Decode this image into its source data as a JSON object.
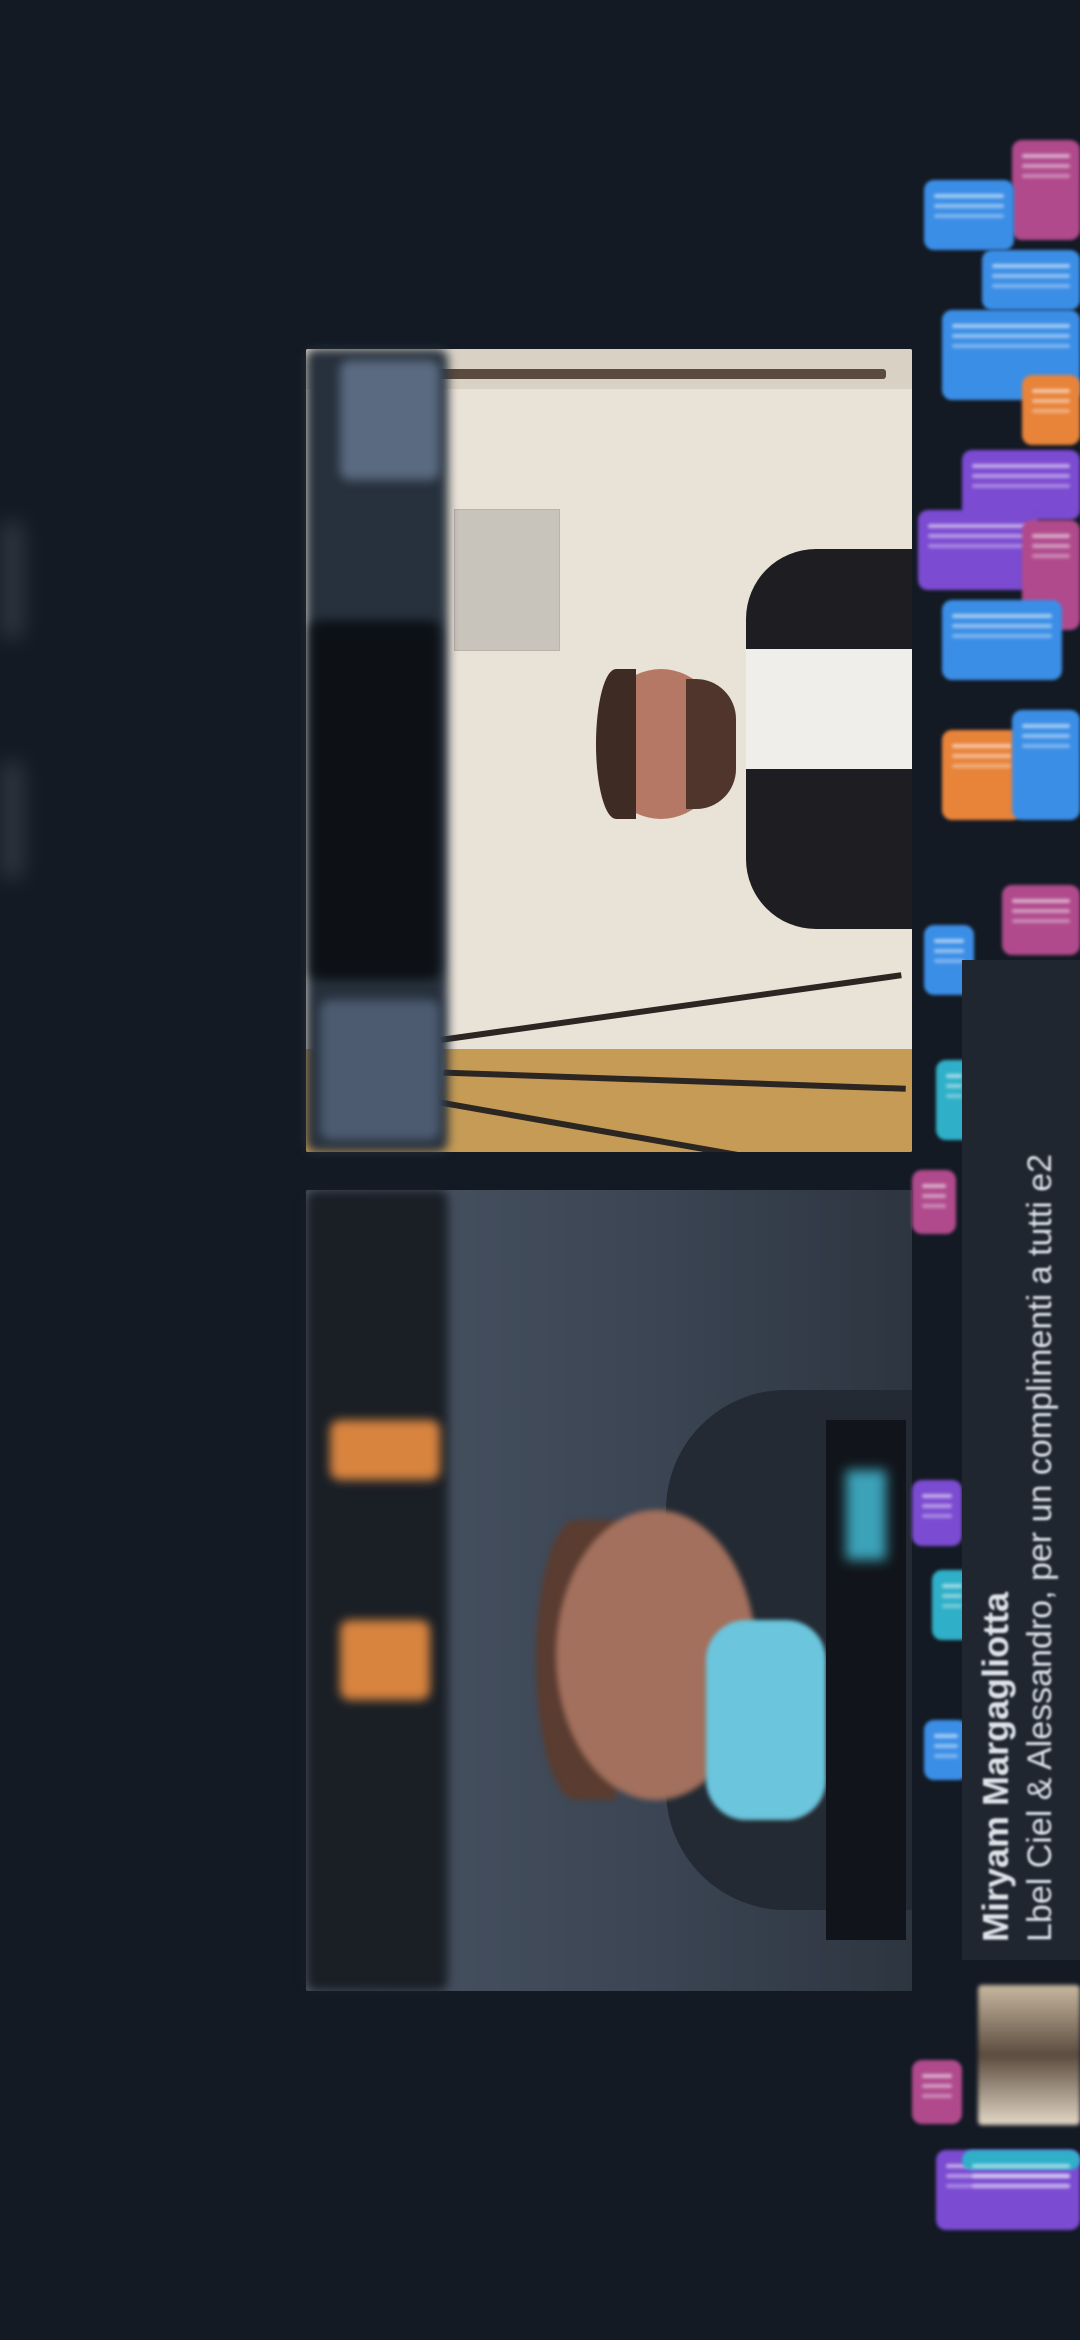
{
  "live_comment": {
    "author": "Miryam Margagliotta",
    "text": "Lbel Ciel & Alessandro, per un complimenti a tutti e2"
  },
  "colors": {
    "background": "#131a24",
    "bubble_blue": "#3b8ee6",
    "bubble_magenta": "#b04a8c",
    "bubble_purple": "#7b4bd1",
    "bubble_orange": "#e8833a",
    "bubble_teal": "#2fb0c8"
  },
  "icons": [
    "comment-bubble-icon",
    "heart-reaction-icon"
  ]
}
